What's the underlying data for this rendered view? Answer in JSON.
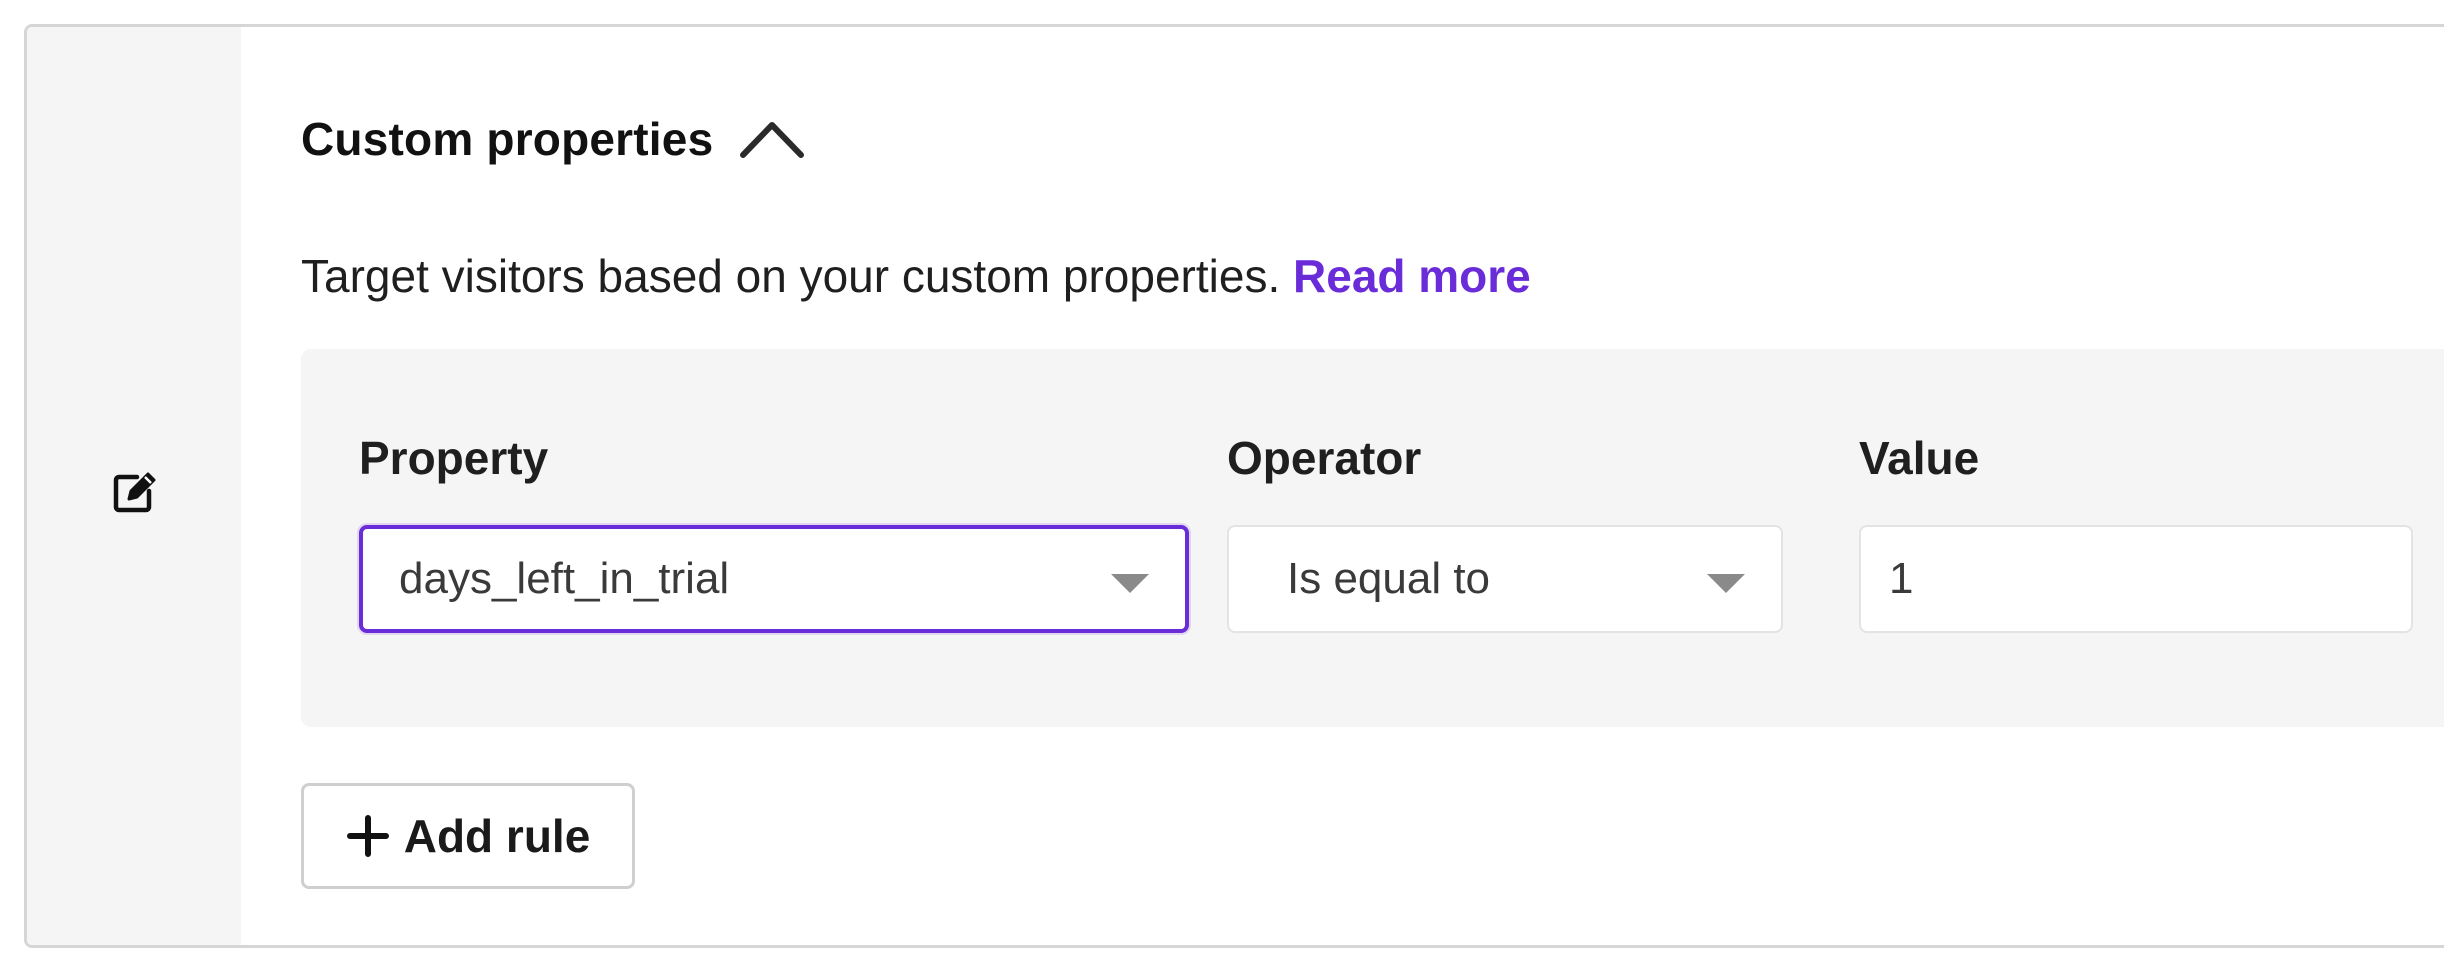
{
  "section": {
    "title": "Custom properties",
    "collapse_icon": "chevron-up-icon",
    "description": "Target visitors based on your custom properties.",
    "read_more": "Read more"
  },
  "rail": {
    "icon": "edit-icon"
  },
  "rule": {
    "property": {
      "label": "Property",
      "value": "days_left_in_trial"
    },
    "operator": {
      "label": "Operator",
      "value": "Is equal to"
    },
    "value_field": {
      "label": "Value",
      "value": "1"
    }
  },
  "add_rule": {
    "label": "Add rule",
    "icon": "plus-icon"
  },
  "colors": {
    "accent": "#6a2bd9",
    "panel_bg": "#f5f5f5",
    "border": "#d6d6d6"
  }
}
